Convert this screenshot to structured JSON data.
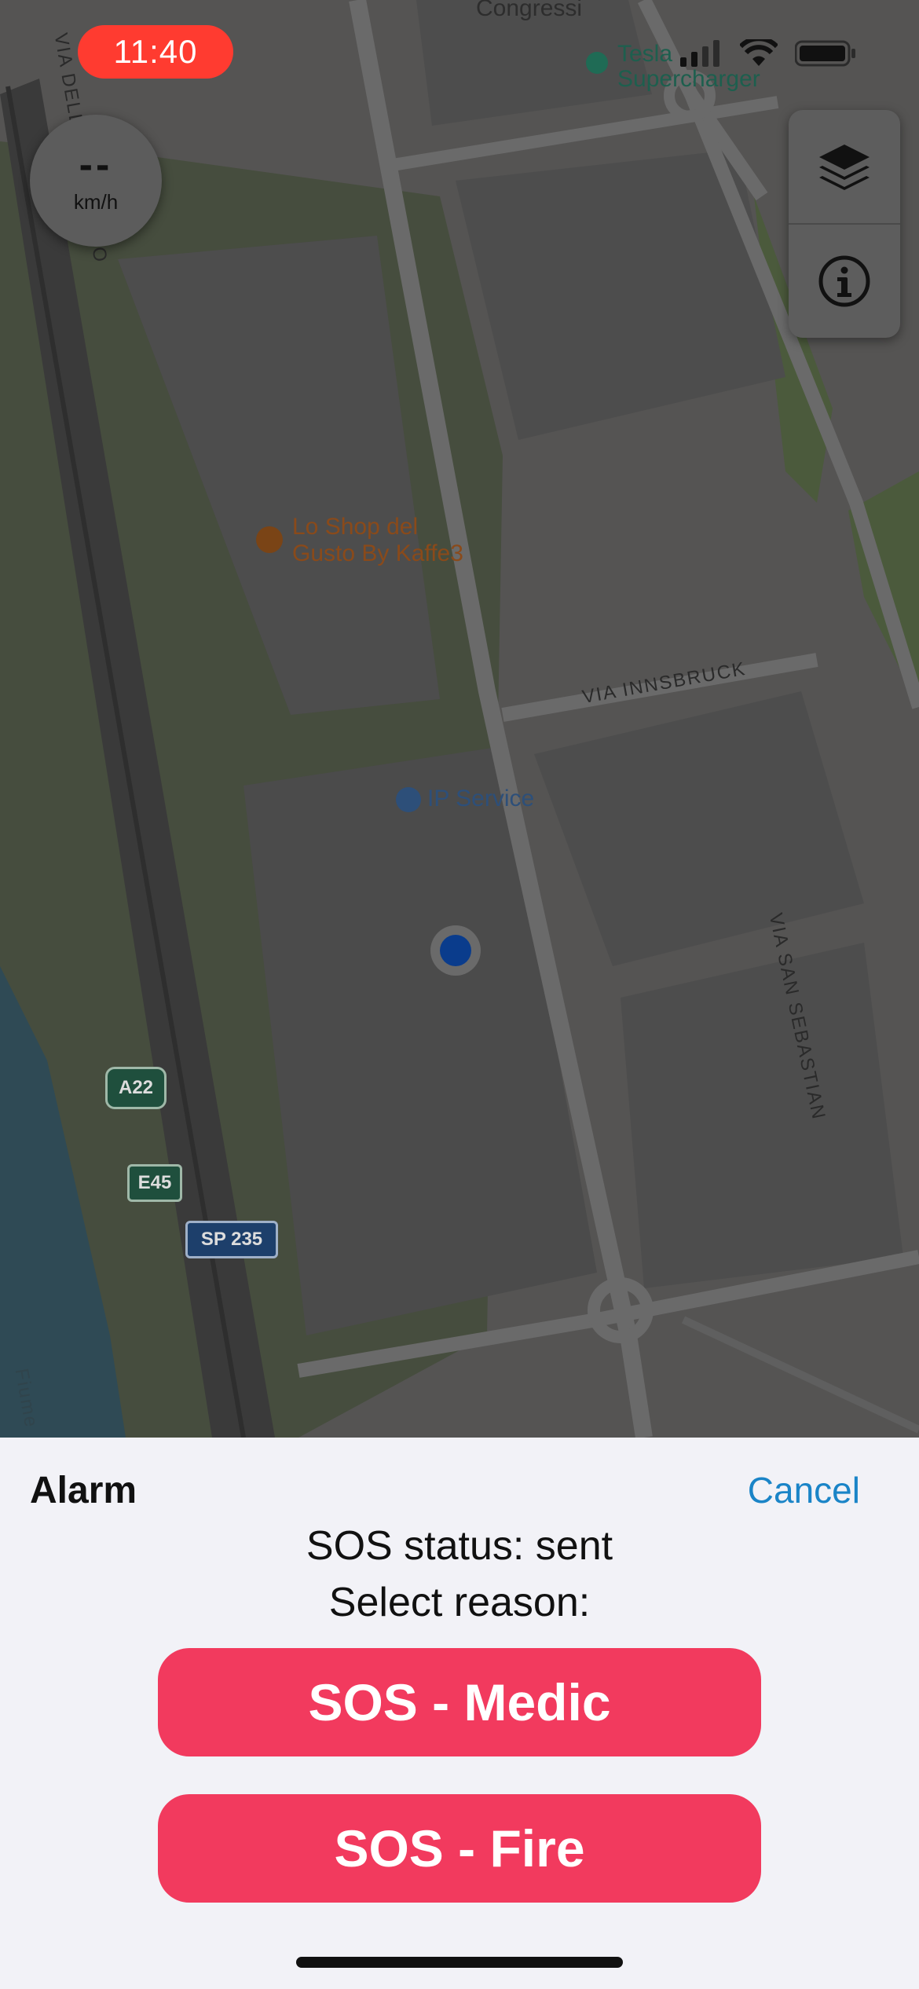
{
  "status_bar": {
    "time": "11:40"
  },
  "speedometer": {
    "value": "--",
    "unit": "km/h"
  },
  "map": {
    "labels": {
      "congress": "Congressi",
      "tesla_line1": "Tesla",
      "tesla_line2": "Supercharger",
      "shop_line1": "Lo Shop del",
      "shop_line2": "Gusto By Kaffe3",
      "ip_service": "IP Service",
      "via_innsbruck": "VIA INNSBRUCK",
      "via_san_sebastian": "VIA SAN SEBASTIAN",
      "via_aeroporto": "VIA DELL'AEROPORTO",
      "fiume": "Fiume"
    },
    "shields": {
      "a22": "A22",
      "e45": "E45",
      "sp235": "SP 235"
    }
  },
  "map_controls": {
    "layers_icon": "layers-icon",
    "info_icon": "info-icon"
  },
  "sheet": {
    "title": "Alarm",
    "cancel": "Cancel",
    "status": "SOS status: sent",
    "prompt": "Select reason:",
    "buttons": {
      "medic": "SOS - Medic",
      "fire": "SOS - Fire"
    }
  },
  "colors": {
    "sos_button": "#f23a5e",
    "cancel_link": "#1a84c7",
    "status_pill": "#ff3b30",
    "location_dot": "#0a3c8c"
  }
}
